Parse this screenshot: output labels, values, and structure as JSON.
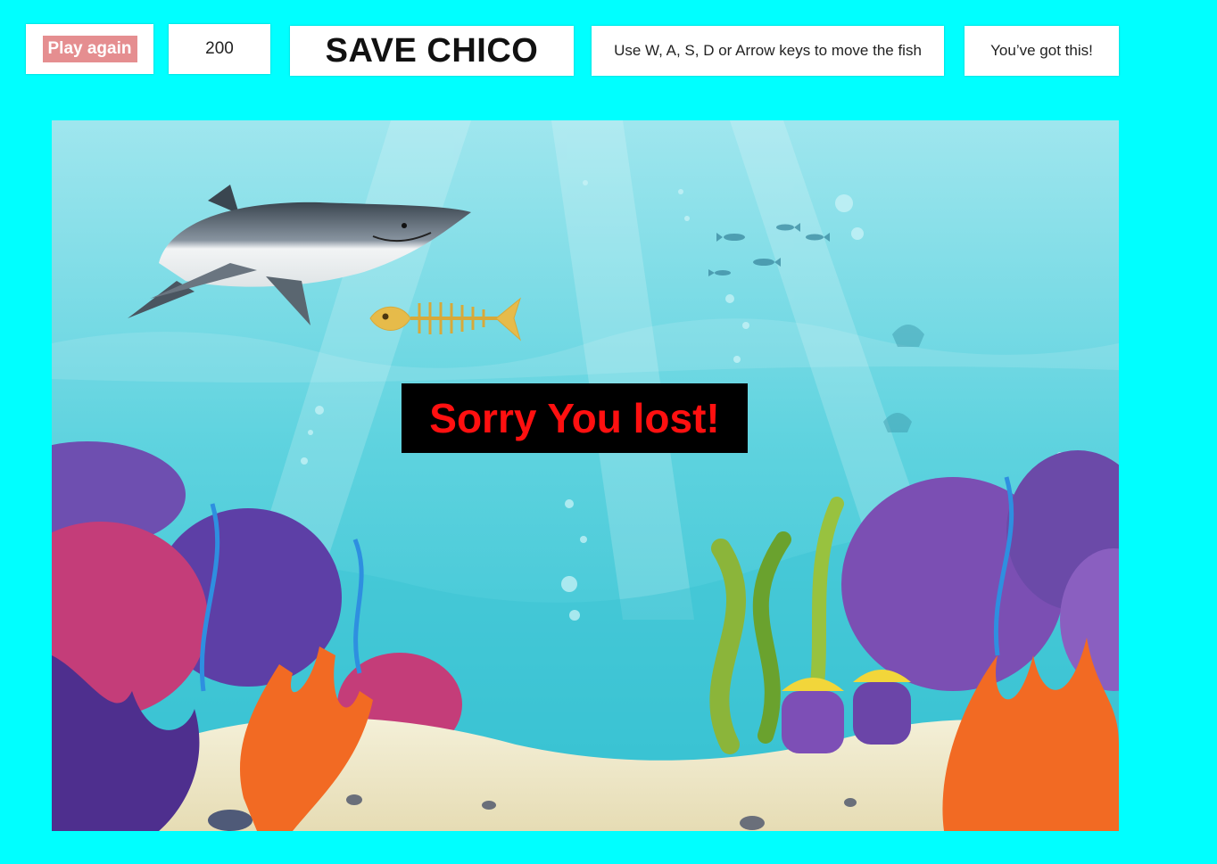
{
  "toolbar": {
    "play_again_label": "Play again",
    "score": "200",
    "title": "SAVE CHICO",
    "instructions": "Use W, A, S, D or Arrow keys to move the fish",
    "encouragement": "You’ve got this!"
  },
  "game": {
    "message": "Sorry You lost!",
    "colors": {
      "page_background": "#00ffff",
      "water": "#55d2de",
      "message_text": "#ff1010",
      "message_background": "#000000",
      "play_button": "#e58e90"
    },
    "sprites": [
      "shark",
      "fish-skeleton",
      "seaweed",
      "coral",
      "sand",
      "bubbles"
    ]
  }
}
